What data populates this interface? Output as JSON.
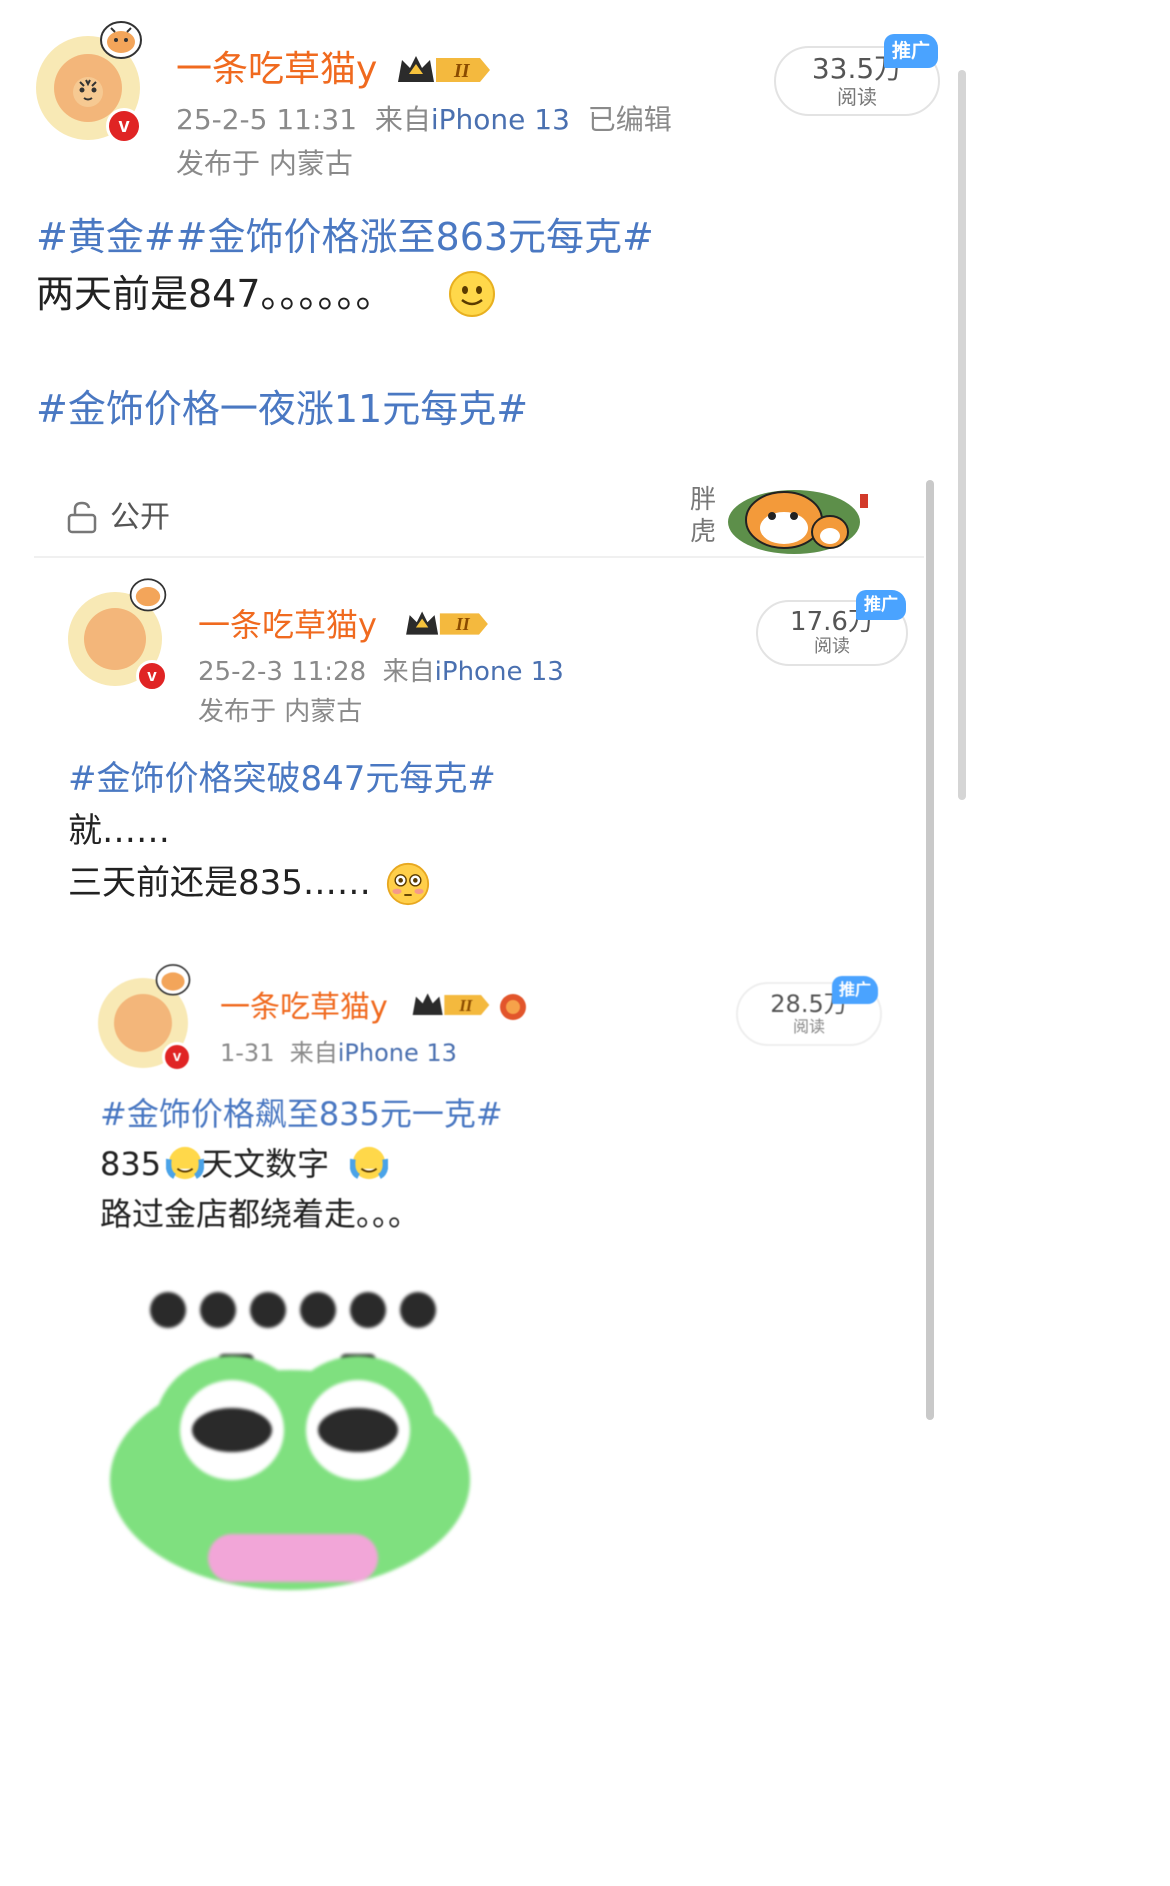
{
  "post": {
    "username": "一条吃草猫y",
    "level": "II",
    "timestamp": "25-2-5 11:31",
    "via_prefix": "来自",
    "device": "iPhone 13",
    "edited": "已编辑",
    "location": "发布于 内蒙古",
    "reads": "33.5万",
    "reads_label": "阅读",
    "promo": "推广",
    "tags_line1": "#黄金##金饰价格涨至863元每克#",
    "text_line2": "两天前是847。。。。。。",
    "tags_line3": "#金饰价格一夜涨11元每克#"
  },
  "shot1": {
    "privacy_label": "公开",
    "sticker_text": "胖虎",
    "username": "一条吃草猫y",
    "level": "II",
    "timestamp": "25-2-3 11:28",
    "via_prefix": "来自",
    "device": "iPhone 13",
    "location": "发布于 内蒙古",
    "reads": "17.6万",
    "reads_label": "阅读",
    "promo": "推广",
    "tag": "#金饰价格突破847元每克#",
    "line2": "就……",
    "line3": "三天前还是835……"
  },
  "shot2": {
    "username": "一条吃草猫y",
    "level": "II",
    "timestamp": "1-31",
    "via_prefix": "来自",
    "device": "iPhone 13",
    "reads": "28.5万",
    "reads_label": "阅读",
    "promo": "推广",
    "tag": "#金饰价格飙至835元一克#",
    "line2_a": "835",
    "line2_b": "天文数字",
    "line3": "路过金店都绕着走。。。"
  },
  "icons": [
    "tiger-avatar-icon",
    "verified-badge-icon",
    "crown-level-icon",
    "smile-emoji-icon",
    "lock-open-icon",
    "flushed-emoji-icon",
    "tears-emoji-icon",
    "frog-sticker-icon"
  ],
  "colors": {
    "username": "#f06a1f",
    "hashtag": "#4a78c2",
    "promo": "#4aa3ff",
    "verified": "#e02424"
  }
}
